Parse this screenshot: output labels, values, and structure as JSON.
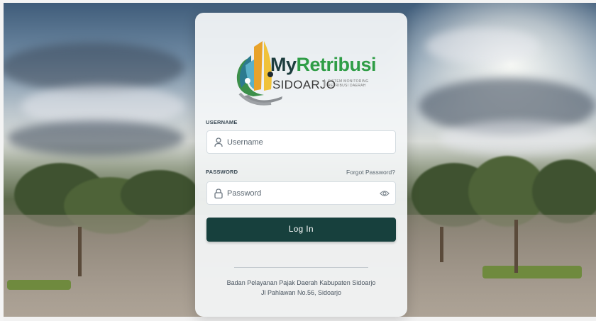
{
  "brand": {
    "title_part1": "My",
    "title_part2": "Retribusi",
    "subtitle": "SIDOARJO",
    "tagline": "SISTEM MONITORING RETRIBUSI DAERAH",
    "colors": {
      "dark": "#1d3d3e",
      "green": "#2f9d46"
    }
  },
  "form": {
    "username": {
      "label": "USERNAME",
      "placeholder": "Username",
      "value": "",
      "icon": "user-icon"
    },
    "password": {
      "label": "PASSWORD",
      "placeholder": "Password",
      "value": "",
      "icon": "lock-icon",
      "toggle_icon": "eye-icon"
    },
    "forgot_link": "Forgot Password?",
    "submit_label": "Log In",
    "submit_color": "#17403d"
  },
  "footer": {
    "line1": "Badan Pelayanan Pajak Daerah Kabupaten Sidoarjo",
    "line2": "Jl Pahlawan No.56, Sidoarjo"
  }
}
